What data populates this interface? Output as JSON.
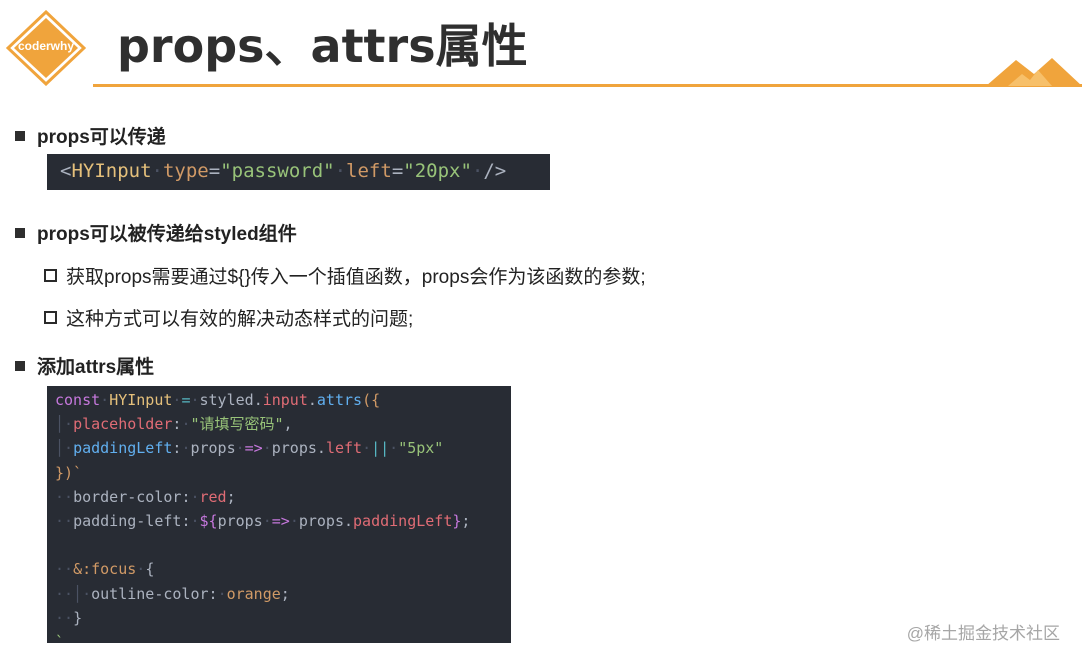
{
  "header": {
    "logo_text": "coderwhy",
    "title": "props、attrs属性",
    "accent_color": "#f0a43c"
  },
  "sections": [
    {
      "label": "props可以传递"
    },
    {
      "label": "props可以被传递给styled组件"
    },
    {
      "label": "添加attrs属性"
    }
  ],
  "sub_items": [
    "获取props需要通过${}传入一个插值函数，props会作为该函数的参数;",
    "这种方式可以有效的解决动态样式的问题;"
  ],
  "code_block_1": {
    "tag_open": "<",
    "component": "HYInput",
    "attr1": "type",
    "eq1": "=",
    "val1": "\"password\"",
    "attr2": "left",
    "eq2": "=",
    "val2": "\"20px\"",
    "close": "/>"
  },
  "code_block_2": {
    "l1_kw": "const",
    "l1_name": "HYInput",
    "l1_eq": "=",
    "l1_obj": "styled",
    "l1_dot1": ".",
    "l1_prop": "input",
    "l1_dot2": ".",
    "l1_fn": "attrs",
    "l1_paren": "({",
    "l2_key": "placeholder",
    "l2_colon": ":",
    "l2_val": "\"请填写密码\"",
    "l2_comma": ",",
    "l3_key": "paddingLeft",
    "l3_colon": ":",
    "l3_arg": "props",
    "l3_arrow": "=>",
    "l3_obj": "props",
    "l3_dot": ".",
    "l3_prop": "left",
    "l3_or": "||",
    "l3_default": "\"5px\"",
    "l4_close": "})`",
    "l5_prop": "border-color",
    "l5_colon": ":",
    "l5_val": "red",
    "l5_semi": ";",
    "l6_prop": "padding-left",
    "l6_colon": ":",
    "l6_interp_open": "${",
    "l6_arg": "props",
    "l6_arrow": "=>",
    "l6_obj": "props",
    "l6_dot": ".",
    "l6_key": "paddingLeft",
    "l6_interp_close": "}",
    "l6_semi": ";",
    "l8_sel": "&:focus",
    "l8_brace": "{",
    "l9_prop": "outline-color",
    "l9_colon": ":",
    "l9_val": "orange",
    "l9_semi": ";",
    "l10_brace": "}",
    "l11_tick": "`"
  },
  "watermark": "@稀土掘金技术社区"
}
